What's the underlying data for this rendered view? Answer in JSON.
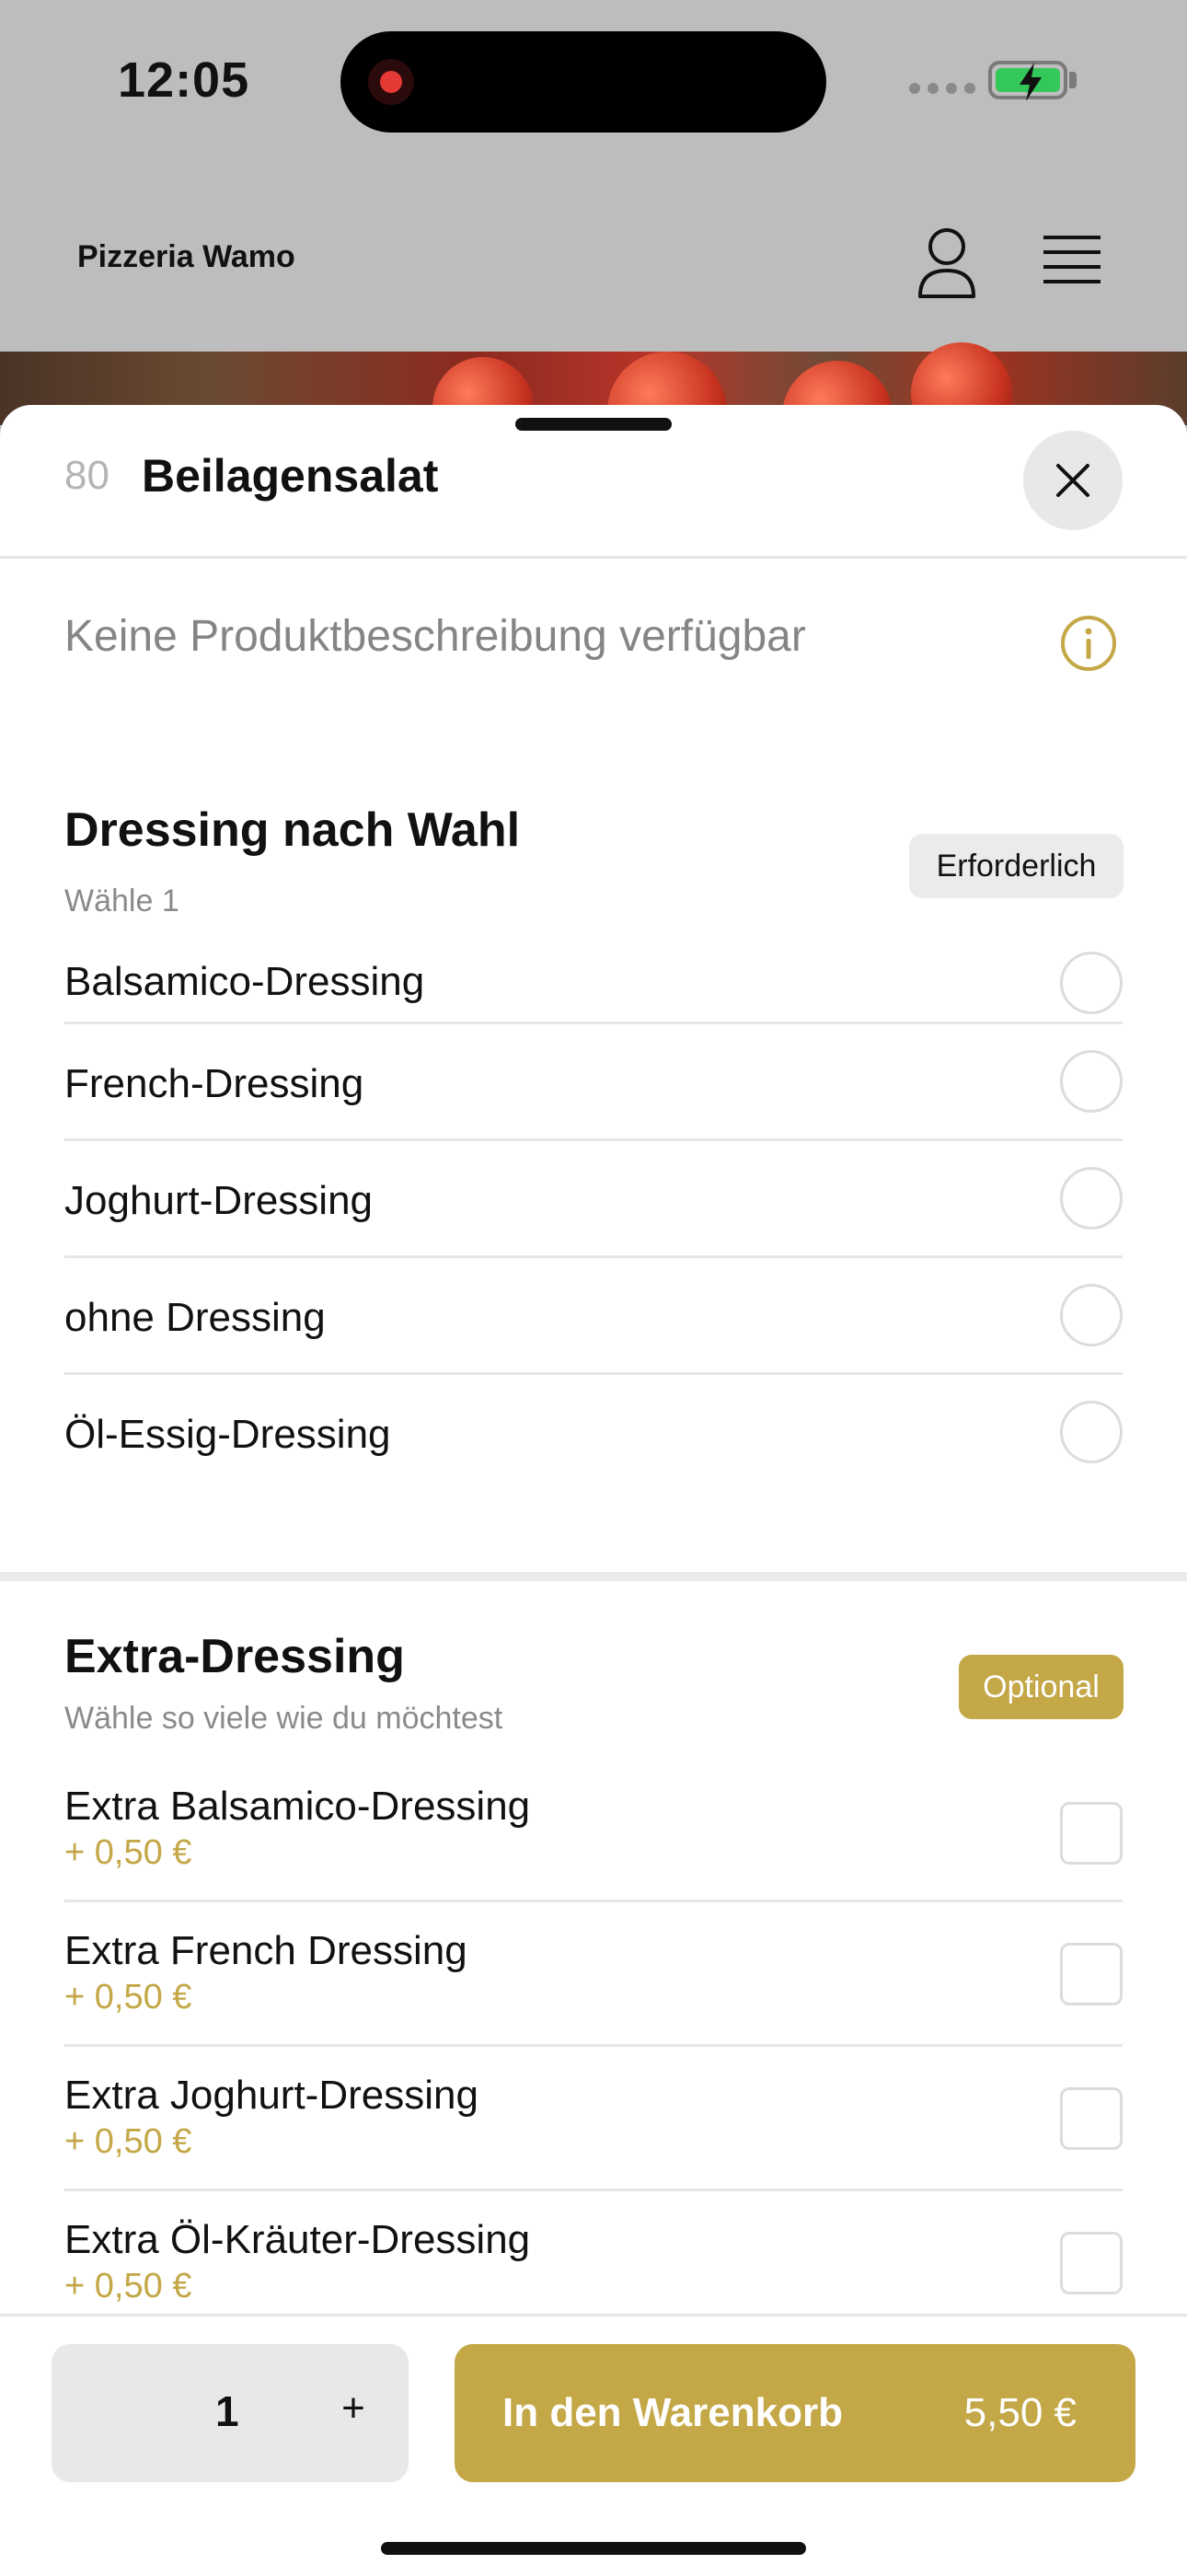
{
  "status_bar": {
    "time": "12:05"
  },
  "header": {
    "brand": "Pizzeria Wamo"
  },
  "sheet": {
    "item_number": "80",
    "item_title": "Beilagensalat",
    "description": "Keine Produktbeschreibung verfügbar"
  },
  "group_dressing": {
    "title": "Dressing nach Wahl",
    "subtitle": "Wähle 1",
    "badge": "Erforderlich",
    "options": [
      {
        "label": "Balsamico-Dressing"
      },
      {
        "label": "French-Dressing"
      },
      {
        "label": "Joghurt-Dressing"
      },
      {
        "label": "ohne Dressing"
      },
      {
        "label": "Öl-Essig-Dressing"
      }
    ]
  },
  "group_extra": {
    "title": "Extra-Dressing",
    "subtitle": "Wähle so viele wie du möchtest",
    "badge": "Optional",
    "options": [
      {
        "label": "Extra Balsamico-Dressing",
        "price": "+ 0,50 €"
      },
      {
        "label": "Extra French Dressing",
        "price": "+ 0,50 €"
      },
      {
        "label": "Extra Joghurt-Dressing",
        "price": "+ 0,50 €"
      },
      {
        "label": "Extra Öl-Kräuter-Dressing",
        "price": "+ 0,50 €"
      }
    ]
  },
  "footer": {
    "quantity": "1",
    "plus": "+",
    "cart_label": "In den Warenkorb",
    "cart_price": "5,50 €"
  },
  "colors": {
    "accent": "#c4a747",
    "battery": "#34c759"
  }
}
